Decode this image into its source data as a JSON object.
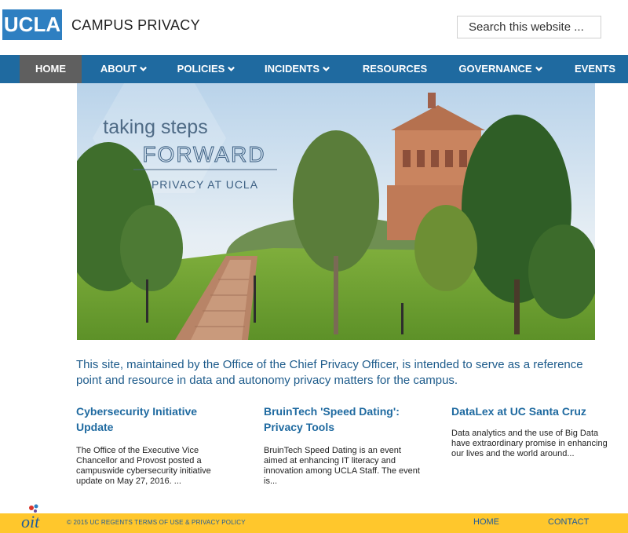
{
  "header": {
    "logo": "UCLA",
    "site_title": "CAMPUS PRIVACY",
    "search_placeholder": "Search this website ..."
  },
  "nav": {
    "items": [
      {
        "label": "HOME",
        "active": true,
        "dropdown": false
      },
      {
        "label": "ABOUT",
        "active": false,
        "dropdown": true
      },
      {
        "label": "POLICIES",
        "active": false,
        "dropdown": true
      },
      {
        "label": "INCIDENTS",
        "active": false,
        "dropdown": true
      },
      {
        "label": "RESOURCES",
        "active": false,
        "dropdown": false
      },
      {
        "label": "GOVERNANCE",
        "active": false,
        "dropdown": true
      },
      {
        "label": "EVENTS",
        "active": false,
        "dropdown": false
      }
    ]
  },
  "hero": {
    "line1": "taking steps",
    "line2": "FORWARD",
    "line3": "PRIVACY AT UCLA"
  },
  "intro": "This site, maintained by the Office of the Chief Privacy Officer, is intended to serve as a reference point and resource in data and autonomy privacy matters for the campus.",
  "cards": [
    {
      "title": "Cybersecurity Initiative Update",
      "body": "The Office of the Executive Vice Chancellor and Provost posted a campuswide cybersecurity initiative update on May 27, 2016. ..."
    },
    {
      "title": "BruinTech 'Speed Dating': Privacy Tools",
      "body": "BruinTech Speed Dating is an event aimed at enhancing IT literacy and innovation among UCLA Staff. The event is..."
    },
    {
      "title": "DataLex at UC Santa Cruz",
      "body": "Data analytics and the use of Big Data have extraordinary promise in enhancing our lives and the world around..."
    }
  ],
  "footer": {
    "logo_text": "oit",
    "copyright": "© 2015 UC REGENTS TERMS OF USE & PRIVACY POLICY",
    "home": "HOME",
    "contact": "CONTACT"
  },
  "colors": {
    "brand_blue": "#2e7fc1",
    "nav_blue": "#1f6aa0",
    "nav_active": "#5f5f5f",
    "footer_gold": "#ffc72c"
  }
}
